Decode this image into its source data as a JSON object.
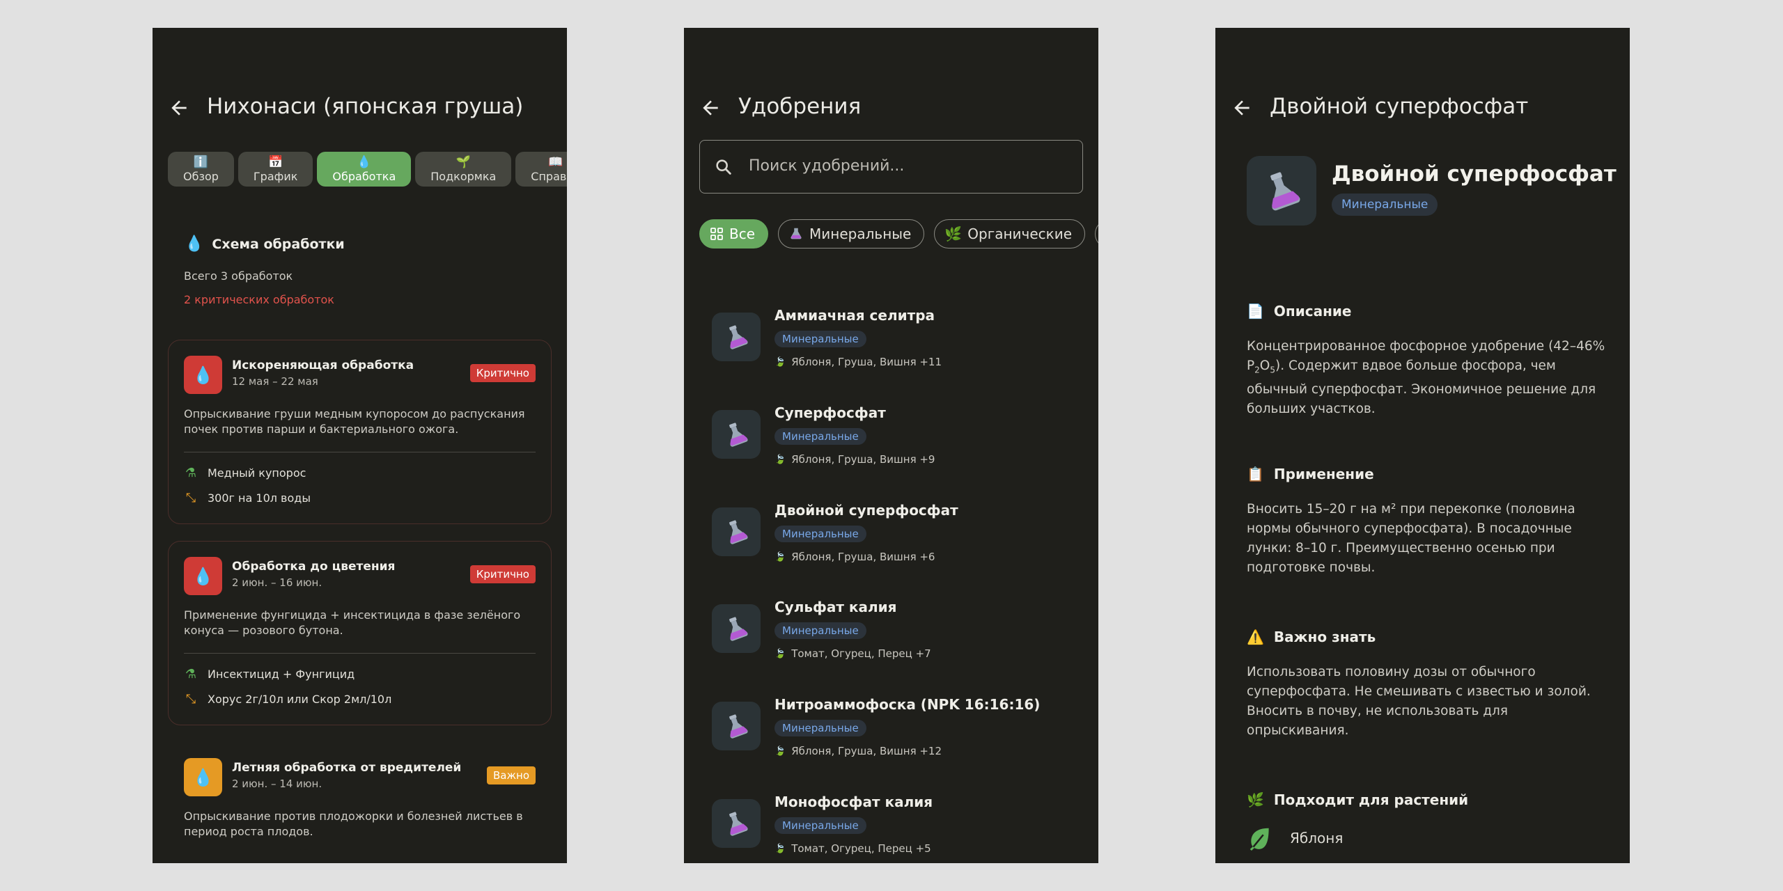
{
  "colors": {
    "background": "#1f1f1b",
    "accent_green": "#66a85e",
    "critical_red": "#cf3b36",
    "important_orange": "#e59a24",
    "tag_blue": "#79a8e8"
  },
  "screen1": {
    "title": "Нихонаси (японская груша)",
    "tabs": [
      {
        "icon": "info-icon",
        "glyph": "ℹ️",
        "label": "Обзор",
        "active": false
      },
      {
        "icon": "calendar-icon",
        "glyph": "📅",
        "label": "График",
        "active": false
      },
      {
        "icon": "droplet-icon",
        "glyph": "💧",
        "label": "Обработка",
        "active": true
      },
      {
        "icon": "seedling-icon",
        "glyph": "🌱",
        "label": "Подкормка",
        "active": false
      },
      {
        "icon": "book-icon",
        "glyph": "📖",
        "label": "Справка",
        "active": false
      }
    ],
    "scheme": {
      "title": "Схема обработки",
      "total": "Всего 3 обработок",
      "critical": "2 критических обработок"
    },
    "treatments": [
      {
        "name": "Искореняющая обработка",
        "dates": "12 мая – 22 мая",
        "badge": "Критично",
        "level": "critical",
        "desc": "Опрыскивание груши медным купоросом до распускания почек против парши и бактериального ожога.",
        "product": "Медный купорос",
        "dose": "300г на 10л воды"
      },
      {
        "name": "Обработка до цветения",
        "dates": "2 июн. – 16 июн.",
        "badge": "Критично",
        "level": "critical",
        "desc": "Применение фунгицида + инсектицида в фазе зелёного конуса — розового бутона.",
        "product": "Инсектицид + Фунгицид",
        "dose": "Хорус 2г/10л или Скор 2мл/10л"
      },
      {
        "name": "Летняя обработка от вредителей",
        "dates": "2 июн. – 14 июн.",
        "badge": "Важно",
        "level": "important",
        "desc": "Опрыскивание против плодожорки и болезней листьев в период роста плодов."
      }
    ]
  },
  "screen2": {
    "title": "Удобрения",
    "search_placeholder": "Поиск удобрений...",
    "filters": [
      {
        "label": "Все",
        "icon": "grid-icon",
        "active": true
      },
      {
        "label": "Минеральные",
        "icon": "flask-icon",
        "active": false
      },
      {
        "label": "Органические",
        "icon": "leaf-icon",
        "active": false
      }
    ],
    "fertilizers": [
      {
        "name": "Аммиачная селитра",
        "tag": "Минеральные",
        "plants": "Яблоня, Груша, Вишня +11"
      },
      {
        "name": "Суперфосфат",
        "tag": "Минеральные",
        "plants": "Яблоня, Груша, Вишня +9"
      },
      {
        "name": "Двойной суперфосфат",
        "tag": "Минеральные",
        "plants": "Яблоня, Груша, Вишня +6"
      },
      {
        "name": "Сульфат калия",
        "tag": "Минеральные",
        "plants": "Томат, Огурец, Перец +7"
      },
      {
        "name": "Нитроаммофоска (NPK 16:16:16)",
        "tag": "Минеральные",
        "plants": "Яблоня, Груша, Вишня +12"
      },
      {
        "name": "Монофосфат калия",
        "tag": "Минеральные",
        "plants": "Томат, Огурец, Перец +5"
      }
    ]
  },
  "screen3": {
    "title": "Двойной суперфосфат",
    "header_name": "Двойной суперфосфат",
    "header_tag": "Минеральные",
    "sections": {
      "description": {
        "title": "Описание",
        "icon": "document-icon",
        "text_before": "Концентрированное фосфорное удобрение (42–46% P",
        "sub1": "2",
        "text_mid": "O",
        "sub2": "5",
        "text_after": "). Содержит вдвое больше фосфора, чем обычный суперфосфат. Экономичное решение для больших участков."
      },
      "application": {
        "title": "Применение",
        "icon": "clipboard-icon",
        "text": "Вносить 15–20 г на м² при перекопке (половина нормы обычного суперфосфата). В посадочные лунки: 8–10 г. Преимущественно осенью при подготовке почвы."
      },
      "important": {
        "title": "Важно знать",
        "icon": "warning-icon",
        "text": "Использовать половину дозы от обычного суперфосфата. Не смешивать с известью и золой. Вносить в почву, не использовать для опрыскивания."
      },
      "plants": {
        "title": "Подходит для растений",
        "icon": "herb-icon",
        "items": [
          "Яблоня"
        ]
      }
    }
  }
}
